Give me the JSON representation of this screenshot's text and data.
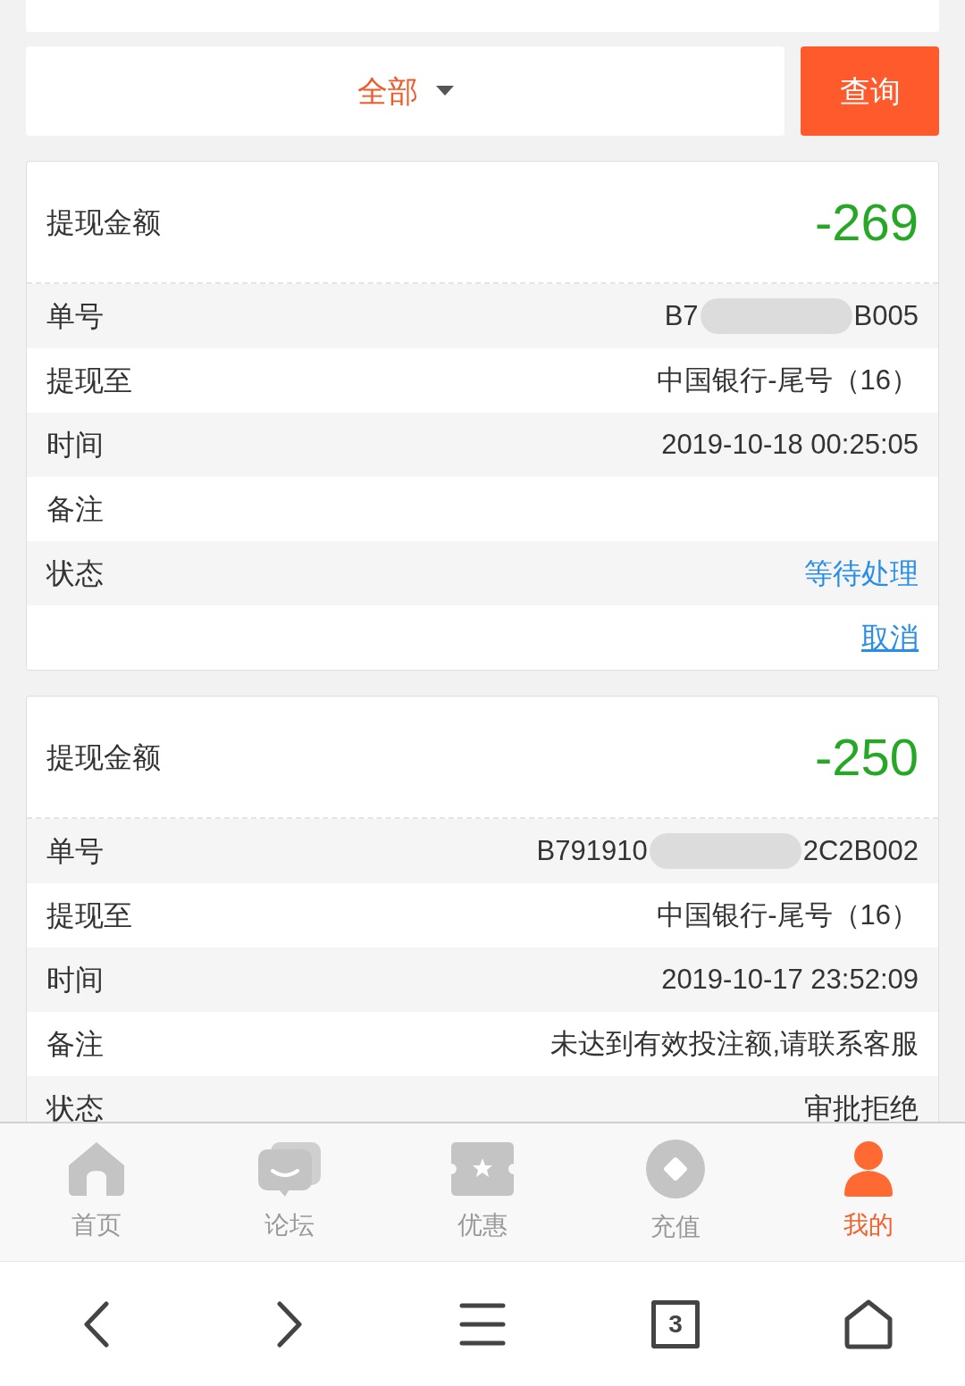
{
  "filter": {
    "value": "全部",
    "button": "查询"
  },
  "records": [
    {
      "amount_label": "提现金额",
      "amount": "-269",
      "order_label": "单号",
      "order_parts": [
        "B7",
        "B005"
      ],
      "account_label": "提现至",
      "account": "中国银行-尾号（16）",
      "time_label": "时间",
      "time": "2019-10-18 00:25:05",
      "note_label": "备注",
      "status_label": "状态",
      "status": {
        "text": "等待处理",
        "kind": "pending"
      },
      "action": "取消"
    },
    {
      "amount_label": "提现金额",
      "amount": "-250",
      "order_label": "单号",
      "order_parts": [
        "B791910",
        "2C2B002"
      ],
      "account_label": "提现至",
      "account": "中国银行-尾号（16）",
      "time_label": "时间",
      "time": "2019-10-17 23:52:09",
      "note_label": "备注",
      "note": "未达到有效投注额,请联系客服",
      "status_label": "状态",
      "status": {
        "text": "审批拒绝",
        "kind": "rejected"
      }
    }
  ],
  "tabs": [
    {
      "label": "首页",
      "kind": "home",
      "selected": false
    },
    {
      "label": "论坛",
      "kind": "forum",
      "selected": false
    },
    {
      "label": "优惠",
      "kind": "coupon",
      "selected": false
    },
    {
      "label": "充值",
      "kind": "coin",
      "selected": false
    },
    {
      "label": "我的",
      "kind": "user",
      "selected": true
    }
  ],
  "browser_bar": {
    "tab_count": "3"
  }
}
